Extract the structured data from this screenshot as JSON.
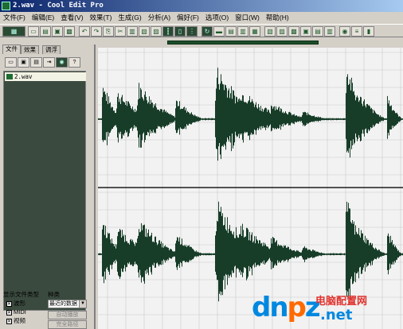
{
  "window": {
    "title": "2.wav - Cool Edit Pro"
  },
  "menu": [
    "文件(F)",
    "编辑(E)",
    "查看(V)",
    "效果(T)",
    "生成(G)",
    "分析(A)",
    "偏好(F)",
    "选项(O)",
    "窗口(W)",
    "帮助(H)"
  ],
  "toolbar_icons": [
    "multitrack-toggle-icon",
    "open-icon",
    "open-append-icon",
    "save-icon",
    "save-all-icon",
    "undo-icon",
    "redo-icon",
    "copy-icon",
    "cut-icon",
    "paste-icon",
    "paste-mix-icon",
    "trim-icon",
    "split-icon",
    "select-entire-icon",
    "snap-icon",
    "loop-icon",
    "view-waveform-icon",
    "view-spectral-icon",
    "view-spectral-pan-icon",
    "view-phase-icon",
    "cue-list-icon",
    "playlist-icon",
    "info-icon",
    "track-properties-icon",
    "settings-icon",
    "fx-icon",
    "cd-icon",
    "eq-icon",
    "meter-icon"
  ],
  "left_panel": {
    "tabs": [
      "文件",
      "效果",
      "调浮"
    ],
    "buttons": [
      "open-file-icon",
      "close-file-icon",
      "mix-paste-icon",
      "insert-icon",
      "help-icon"
    ],
    "files": [
      "2.wav"
    ],
    "filter_label": "显示文件类型",
    "sort_label": "种类",
    "filters": [
      {
        "label": "波形",
        "checked": true
      },
      {
        "label": "MIDI",
        "checked": true
      },
      {
        "label": "视频",
        "checked": true
      }
    ],
    "sort_value": "最近的数据",
    "buttons_bottom": [
      "自动播放",
      "完全路径"
    ]
  },
  "watermark": {
    "logo": "dnpz",
    "cn": "电脑配置网",
    "domain": ".net"
  },
  "colors": {
    "waveform": "#173d28",
    "titlebar": "#0a246a",
    "wave_bg": "#f2f2f2"
  }
}
